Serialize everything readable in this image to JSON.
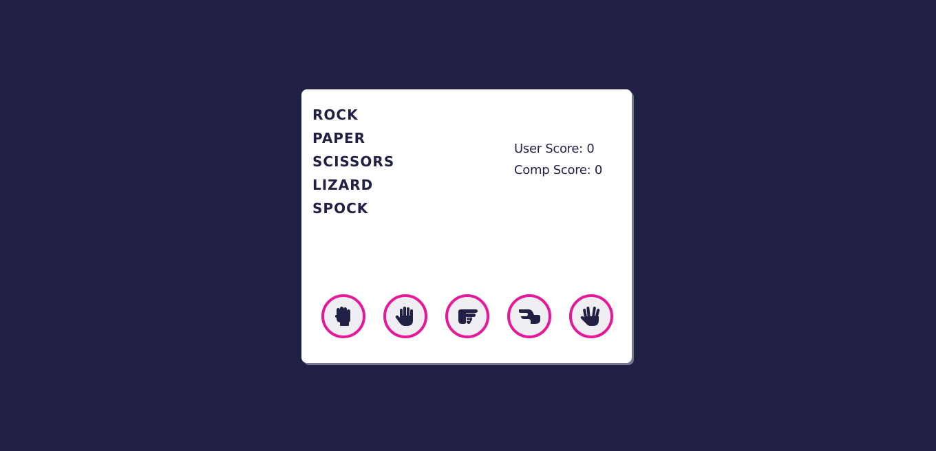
{
  "title_words": [
    "ROCK",
    "PAPER",
    "SCISSORS",
    "LIZARD",
    "SPOCK"
  ],
  "scores": {
    "user_label": "User Score: ",
    "user_value": "0",
    "comp_label": "Comp Score: ",
    "comp_value": "0"
  },
  "choices": [
    {
      "name": "rock",
      "icon": "hand-rock-icon"
    },
    {
      "name": "paper",
      "icon": "hand-paper-icon"
    },
    {
      "name": "scissors",
      "icon": "hand-scissors-icon"
    },
    {
      "name": "lizard",
      "icon": "hand-lizard-icon"
    },
    {
      "name": "spock",
      "icon": "hand-spock-icon"
    }
  ],
  "colors": {
    "background": "#1f2044",
    "card": "#ffffff",
    "text": "#1f2044",
    "accent": "#e3199a",
    "button_fill": "#efeff3"
  }
}
